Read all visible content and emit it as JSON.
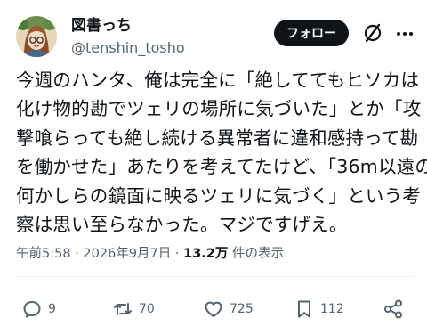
{
  "user": {
    "display_name": "図書っち",
    "handle": "@tenshin_tosho"
  },
  "header": {
    "follow_label": "フォロー"
  },
  "post": {
    "lines": [
      "今週のハンタ、俺は完全に「絶しててもヒソカは",
      "化け物的勘でツェリの場所に気づいた」とか「攻",
      "撃喰らっても絶し続ける異常者に違和感持って勘",
      "を働かせた」あたりを考えてたけど、「36m以遠の",
      "何かしらの鏡面に映るツェリに気づく」という考",
      "察は思い至らなかった。マジですげえ。"
    ]
  },
  "meta": {
    "time": "午前5:58",
    "sep1": " · ",
    "date": "2026年9月7日",
    "sep2": " · ",
    "views": "13.2万",
    "views_suffix": " 件の表示"
  },
  "actions": {
    "reply_count": "9",
    "retweet_count": "70",
    "like_count": "725",
    "bookmark_count": "112"
  },
  "icons": [
    "avatar",
    "grok-icon",
    "more-icon",
    "reply-icon",
    "retweet-icon",
    "like-icon",
    "bookmark-icon",
    "share-icon"
  ],
  "colors": {
    "text": "#0f1419",
    "secondary": "#536471",
    "button_bg": "#0f1419"
  }
}
